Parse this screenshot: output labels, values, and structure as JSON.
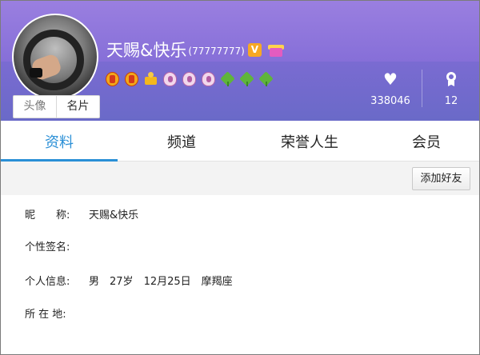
{
  "profile": {
    "nickname": "天赐&快乐",
    "qq_number": "(77777777)",
    "vip_icon": "vip-badge-icon",
    "gift_icon": "gift-icon",
    "avatar_tab": "头像",
    "card_tab": "名片",
    "like_count": "338046",
    "medal_count": "12",
    "badges": [
      "crown-red-icon",
      "crown-red-icon",
      "crown-gold-icon",
      "shield-icon",
      "shield-icon",
      "shield-icon",
      "leaf-icon",
      "leaf-icon",
      "leaf-icon"
    ]
  },
  "tabs": {
    "t1": "资料",
    "t2": "频道",
    "t3": "荣誉人生",
    "t4": "会员"
  },
  "actions": {
    "add_friend": "添加好友"
  },
  "info": {
    "nick_label": "昵　　称:",
    "nick_value": "天赐&快乐",
    "sign_label": "个性签名:",
    "personal_label": "个人信息:",
    "gender": "男",
    "age": "27岁",
    "birthday": "12月25日",
    "zodiac": "摩羯座",
    "location_label": "所 在 地:"
  },
  "colors": {
    "header": "#7b6bd2",
    "active_tab": "#2a8fd6"
  }
}
